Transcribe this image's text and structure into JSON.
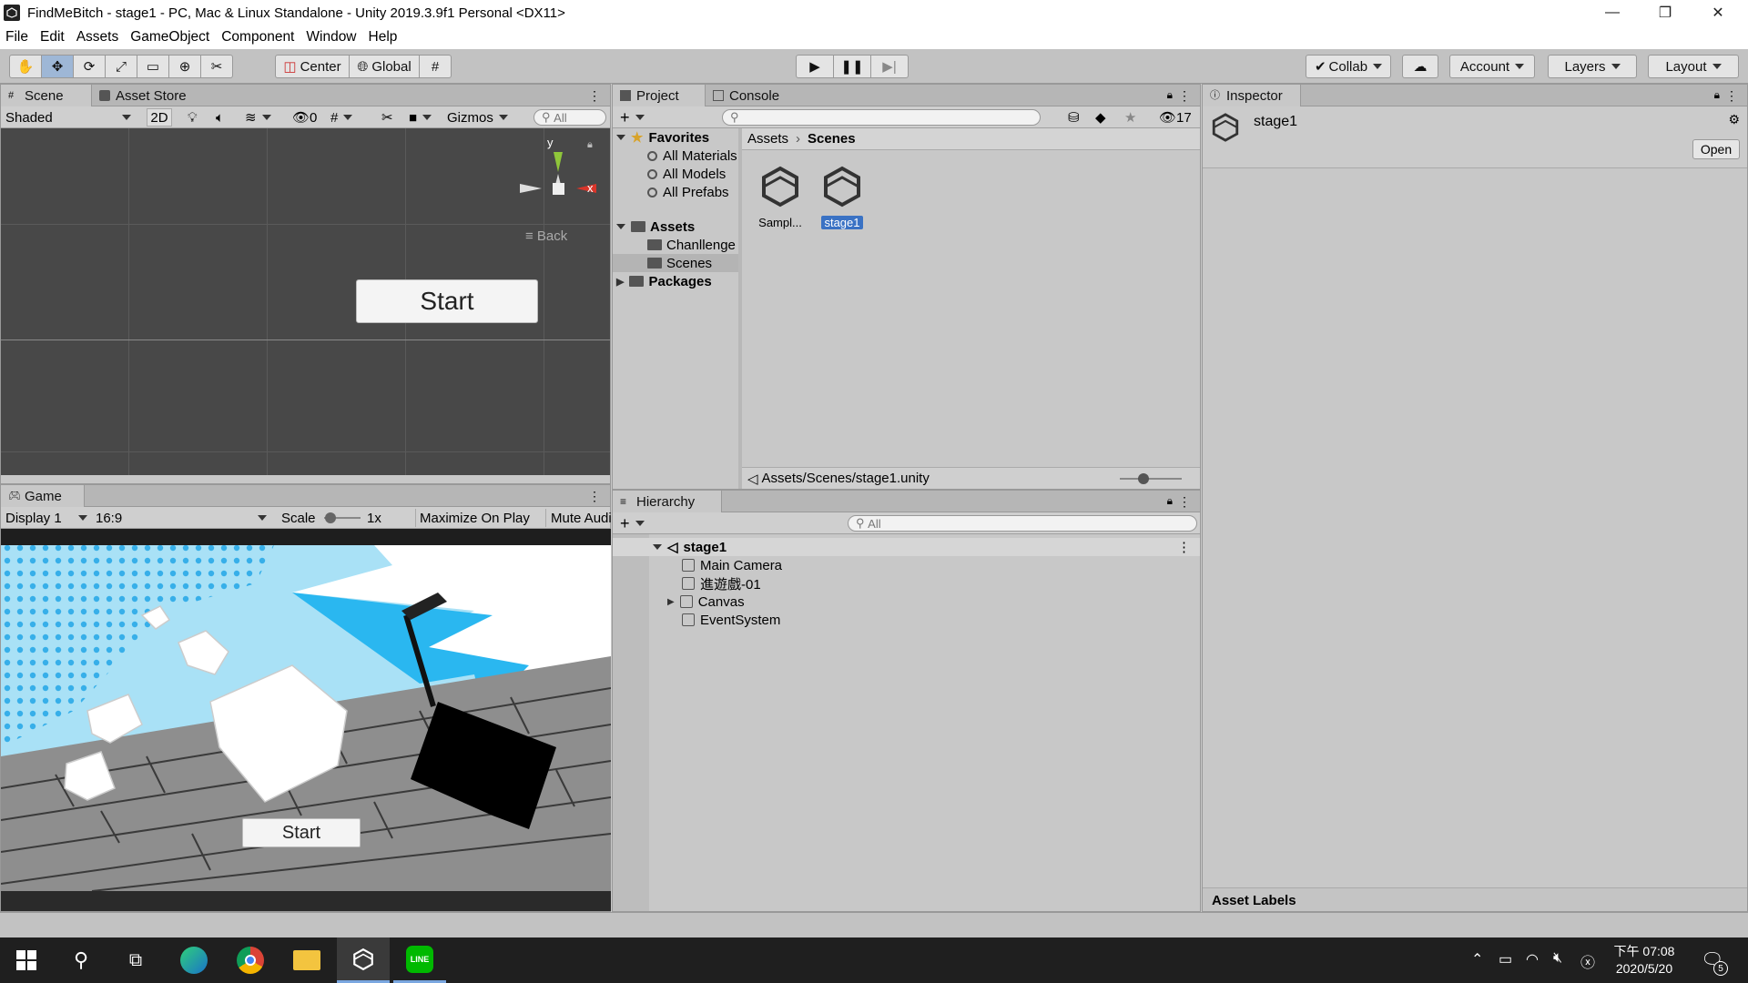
{
  "window": {
    "title": "FindMeBitch - stage1 - PC, Mac & Linux Standalone - Unity 2019.3.9f1 Personal <DX11>",
    "controls": [
      "—",
      "❐",
      "✕"
    ]
  },
  "menubar": [
    "File",
    "Edit",
    "Assets",
    "GameObject",
    "Component",
    "Window",
    "Help"
  ],
  "toolbar": {
    "tools": [
      "hand-icon",
      "move-icon",
      "rotate-icon",
      "scale-icon",
      "rect-icon",
      "transform-icon",
      "custom-tool-icon"
    ],
    "pivot": "Center",
    "space": "Global",
    "collab": "Collab",
    "account": "Account",
    "layers": "Layers",
    "layout": "Layout"
  },
  "scene": {
    "tabs": [
      "Scene",
      "Asset Store"
    ],
    "shading": "Shaded",
    "mode_2d": "2D",
    "hidden_count": "0",
    "gizmos": "Gizmos",
    "search_placeholder": "All",
    "gizmo_y": "y",
    "gizmo_x": "x",
    "view_label": "Back",
    "start_button": "Start"
  },
  "game": {
    "tab": "Game",
    "display": "Display 1",
    "aspect": "16:9",
    "scale_label": "Scale",
    "scale_value": "1x",
    "maximize": "Maximize On Play",
    "mute": "Mute Audio",
    "start_button": "Start"
  },
  "project": {
    "tabs": [
      "Project",
      "Console"
    ],
    "hidden_count": "17",
    "favorites_label": "Favorites",
    "favorites": [
      "All Materials",
      "All Models",
      "All Prefabs"
    ],
    "assets_label": "Assets",
    "asset_folders": [
      "Chanllenge",
      "Scenes"
    ],
    "packages_label": "Packages",
    "breadcrumb": [
      "Assets",
      "Scenes"
    ],
    "files": [
      "Sampl...",
      "stage1"
    ],
    "selected_path": "Assets/Scenes/stage1.unity"
  },
  "hierarchy": {
    "tab": "Hierarchy",
    "search_placeholder": "All",
    "scene_name": "stage1",
    "items": [
      "Main Camera",
      "進遊戲-01",
      "Canvas",
      "EventSystem"
    ]
  },
  "inspector": {
    "tab": "Inspector",
    "object_name": "stage1",
    "open_button": "Open",
    "asset_labels": "Asset Labels"
  },
  "taskbar": {
    "clock_time": "下午 07:08",
    "clock_date": "2020/5/20",
    "notification_count": "5"
  }
}
